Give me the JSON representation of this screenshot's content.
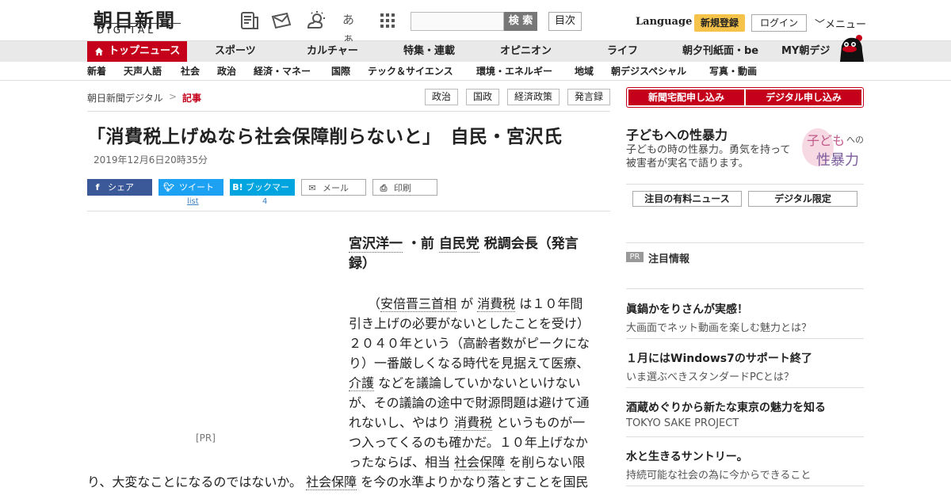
{
  "header": {
    "logo_main": "朝日新聞",
    "logo_sub": "DIGITAL",
    "icons": [
      "paper-icon",
      "mail-icon",
      "weather-icon",
      "font-size-icon",
      "apps-grid-icon"
    ],
    "font_icon_text": "あぁ",
    "search_button": "検 索",
    "toc_button": "目次",
    "language": "Language",
    "signup": "新規登録",
    "login": "ログイン",
    "menu": "メニュー"
  },
  "nav1": {
    "top": "トップニュース",
    "items": [
      "スポーツ",
      "カルチャー",
      "特集・連載",
      "オピニオン",
      "ライフ",
      "朝夕刊紙面・be",
      "MY朝デジ"
    ]
  },
  "nav2": {
    "items": [
      "新着",
      "天声人語",
      "社会",
      "政治",
      "経済・マネー",
      "国際",
      "テック＆サイエンス",
      "環境・エネルギー",
      "地域",
      "朝デジスペシャル",
      "写真・動画"
    ]
  },
  "breadcrumb": {
    "home": "朝日新聞デジタル",
    "separator": ">",
    "current": "記事"
  },
  "tags": [
    "政治",
    "国政",
    "経済政策",
    "発言録"
  ],
  "article": {
    "title": "「消費税上げぬなら社会保障削らないと」　自民・宮沢氏",
    "date": "2019年12月6日20時35分",
    "share": {
      "facebook": "シェア",
      "twitter": "ツイート",
      "hatena": "ブックマーク",
      "mail": "メール",
      "print": "印刷",
      "twitter_count": "list",
      "hatena_count": "4"
    },
    "ad_label": "[PR]",
    "speaker": {
      "name": "宮沢洋一",
      "mid": " ・前 ",
      "party": "自民党",
      "role": " 税調会長（発言録）"
    },
    "paragraph": {
      "p1": "（",
      "k1": "安倍晋三首相",
      "p2": " が ",
      "k2": "消費税",
      "p3": " は１０年間引き上げの必要がないとしたことを受け）２０４０年という（高齢者数がピークになり）一番厳しくなる時代を見据えて医療、",
      "k3": "介護",
      "p4": " などを議論していかないといけないが、その議論の途中で財源問題は避けて通れないし、やはり ",
      "k4": "消費税",
      "p5": " というものが一つ入ってくるのも確かだ。１０年上げなかったならば、相当 ",
      "k5": "社会保障",
      "p6": " を削らない限"
    },
    "tail": {
      "t1": "り、大変なことになるのではないか。 ",
      "k1": "社会保障",
      "t2": " を今の水準よりかなり落とすことを国民"
    }
  },
  "sidebar": {
    "subscribe_paper": "新聞宅配申し込み",
    "subscribe_digital": "デジタル申し込み",
    "feature": {
      "title": "子どもへの性暴力",
      "desc": "子どもの時の性暴力。勇気を持って被害者が実名で語ります。",
      "logo_line1": "子ども",
      "logo_small": "への",
      "logo_line2": "性暴力"
    },
    "paid_news": "注目の有料ニュース",
    "digital_only": "デジタル限定",
    "pr_badge": "PR",
    "pr_heading": "注目情報",
    "pr_items": [
      {
        "title": "眞鍋かをりさんが実感！",
        "sub": "大画面でネット動画を楽しむ魅力とは？"
      },
      {
        "title": "１月にはWindows7のサポート終了",
        "sub": "いま選ぶべきスタンダードPCとは？"
      },
      {
        "title": "酒蔵めぐりから新たな東京の魅力を知る",
        "sub": "TOKYO SAKE PROJECT"
      },
      {
        "title": "水と生きるサントリー。",
        "sub": "持続可能な社会の為に今からできること"
      }
    ]
  },
  "colors": {
    "brand_red": "#c4001a",
    "signup_yellow": "#f5c24a",
    "facebook": "#3b5998",
    "twitter": "#1da1f2",
    "hatena": "#00a4de"
  }
}
